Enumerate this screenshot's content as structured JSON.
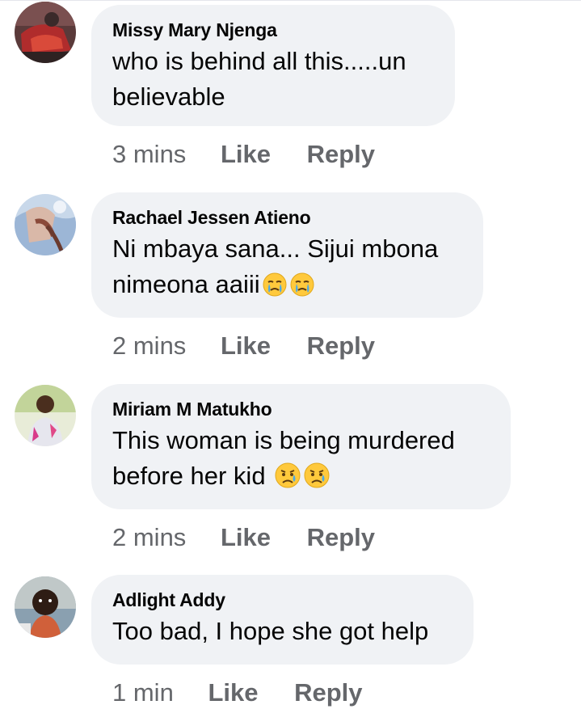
{
  "comments": [
    {
      "author": "Missy Mary Njenga",
      "text_line1": "who is behind all this.....un",
      "text_line2": "believable",
      "time": "3 mins",
      "like": "Like",
      "reply": "Reply",
      "avatar_icon": "profile-photo"
    },
    {
      "author": "Rachael Jessen Atieno",
      "text_line1": "Ni mbaya sana... Sijui mbona",
      "text_line2": "nimeona aaiii",
      "emojis": [
        "crying-face-icon",
        "crying-face-icon"
      ],
      "time": "2 mins",
      "like": "Like",
      "reply": "Reply",
      "avatar_icon": "profile-photo"
    },
    {
      "author": "Miriam M Matukho",
      "text_line1": "This woman is being murdered",
      "text_line2": "before her kid",
      "emojis": [
        "sad-but-relieved-face-icon",
        "sad-but-relieved-face-icon"
      ],
      "time": "2 mins",
      "like": "Like",
      "reply": "Reply",
      "avatar_icon": "profile-photo"
    },
    {
      "author": "Adlight Addy",
      "text_line1": "Too bad, I hope she got help",
      "time": "1 min",
      "like": "Like",
      "reply": "Reply",
      "avatar_icon": "profile-photo"
    }
  ]
}
